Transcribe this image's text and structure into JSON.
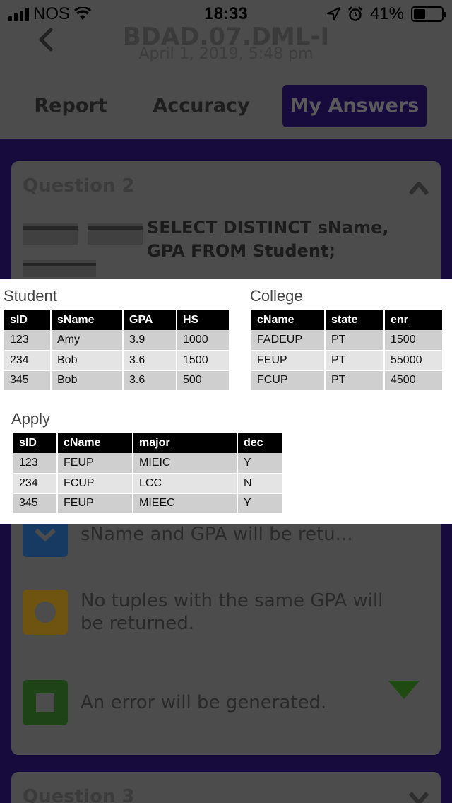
{
  "status_bar": {
    "carrier": "NOS",
    "time": "18:33",
    "battery": "41%",
    "battery_level": 0.41
  },
  "header": {
    "title": "BDAD.07.DML-I",
    "subtitle": "April 1, 2019, 5:48 pm"
  },
  "tabs": [
    {
      "label": "Report"
    },
    {
      "label": "Accuracy"
    },
    {
      "label": "My Answers"
    }
  ],
  "question": {
    "title": "Question 2",
    "sql": "SELECT DISTINCT sName, GPA FROM Student;"
  },
  "options": [
    {
      "text": "sName and GPA will be retu..."
    },
    {
      "text": "No tuples with the same GPA will be returned."
    },
    {
      "text": "An error will be generated."
    }
  ],
  "next_question": {
    "title": "Question 3"
  },
  "overlay": {
    "student": {
      "label": "Student",
      "headers": [
        "sID",
        "sName",
        "GPA",
        "HS"
      ],
      "rows": [
        [
          "123",
          "Amy",
          "3.9",
          "1000"
        ],
        [
          "234",
          "Bob",
          "3.6",
          "1500"
        ],
        [
          "345",
          "Bob",
          "3.6",
          "500"
        ]
      ]
    },
    "college": {
      "label": "College",
      "headers": [
        "cName",
        "state",
        "enr"
      ],
      "rows": [
        [
          "FADEUP",
          "PT",
          "1500"
        ],
        [
          "FEUP",
          "PT",
          "55000"
        ],
        [
          "FCUP",
          "PT",
          "4500"
        ]
      ]
    },
    "apply": {
      "label": "Apply",
      "headers": [
        "sID",
        "cName",
        "major",
        "dec"
      ],
      "rows": [
        [
          "123",
          "FEUP",
          "MIEIC",
          "Y"
        ],
        [
          "234",
          "FCUP",
          "LCC",
          "N"
        ],
        [
          "345",
          "FEUP",
          "MIEEC",
          "Y"
        ]
      ]
    }
  },
  "colors": {
    "brand_dark": "#170a3d",
    "option_blue": "#173a63",
    "option_yellow": "#6e5410",
    "option_green": "#1e4317"
  },
  "icons": [
    "back-chevron-icon",
    "wifi-icon",
    "location-icon",
    "alarm-icon",
    "battery-icon",
    "chevron-up-icon",
    "chevron-down-icon",
    "check-icon",
    "circle-icon",
    "square-icon",
    "checkmark-icon"
  ]
}
